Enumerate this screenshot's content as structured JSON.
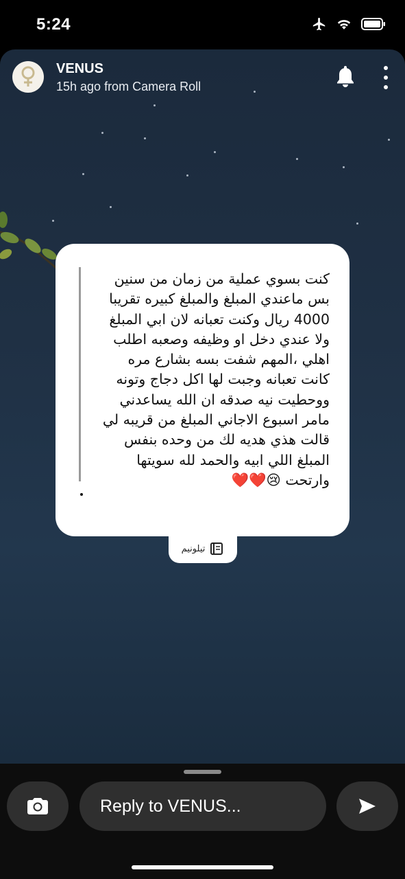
{
  "status": {
    "time": "5:24",
    "icons": [
      "airplane-icon",
      "wifi-icon",
      "battery-icon"
    ]
  },
  "story": {
    "sender": "VENUS",
    "meta": "15h ago from Camera Roll",
    "avatar_icon": "venus-symbol-icon"
  },
  "card": {
    "lines": [
      "كنت بسوي عملية من زمان من سنين",
      "بس ماعندي المبلغ والمبلغ كبيره تقريبا",
      "4000 ريال وكنت تعبانه لان ابي المبلغ",
      "ولا عندي دخل او وظيفه وصعبه اطلب",
      "اهلي ،المهم شفت بسه بشارع مره",
      "كانت تعبانه وجبت لها اكل دجاج وتونه",
      "ووحطيت نيه صدقه ان الله يساعدني",
      "مامر اسبوع الاجاني المبلغ من قريبه لي",
      "قالت هذي هديه لك من وحده بنفس",
      "المبلغ اللي ابيه والحمد لله سويتها",
      "وارتحت 😢❤️❤️"
    ],
    "dot": "."
  },
  "tag": {
    "label": "تيلونيم"
  },
  "reply": {
    "placeholder": "Reply to VENUS..."
  },
  "colors": {
    "background": "#1f3044",
    "card": "#ffffff",
    "bar": "#0d0d0d",
    "pill": "#2f2f2f"
  }
}
